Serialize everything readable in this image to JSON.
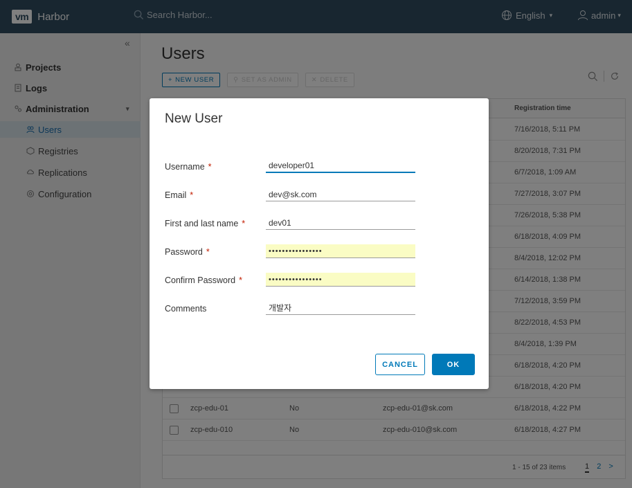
{
  "header": {
    "logo": "vm",
    "app_name": "Harbor",
    "search_placeholder": "Search Harbor...",
    "language": "English",
    "user": "admin"
  },
  "sidebar": {
    "items": [
      {
        "label": "Projects"
      },
      {
        "label": "Logs"
      },
      {
        "label": "Administration"
      }
    ],
    "sub_items": [
      {
        "label": "Users"
      },
      {
        "label": "Registries"
      },
      {
        "label": "Replications"
      },
      {
        "label": "Configuration"
      }
    ]
  },
  "main": {
    "title": "Users",
    "toolbar": {
      "new_user": "NEW USER",
      "set_admin": "SET AS ADMIN",
      "delete": "DELETE"
    },
    "grid": {
      "registration_header": "Registration time",
      "registration_times": [
        "7/16/2018, 5:11 PM",
        "8/20/2018, 7:31 PM",
        "6/7/2018, 1:09 AM",
        "7/27/2018, 3:07 PM",
        "7/26/2018, 5:38 PM",
        "6/18/2018, 4:09 PM",
        "8/4/2018, 12:02 PM",
        "6/14/2018, 1:38 PM",
        "7/12/2018, 3:59 PM",
        "8/22/2018, 4:53 PM",
        "8/4/2018, 1:39 PM",
        "6/18/2018, 4:20 PM",
        "6/18/2018, 4:20 PM"
      ],
      "rows": [
        {
          "username": "zcp-edu-01",
          "admin": "No",
          "email": "zcp-edu-01@sk.com",
          "time": "6/18/2018, 4:22 PM"
        },
        {
          "username": "zcp-edu-010",
          "admin": "No",
          "email": "zcp-edu-010@sk.com",
          "time": "6/18/2018, 4:27 PM"
        }
      ],
      "footer": {
        "count": "1 - 15 of 23 items",
        "page1": "1",
        "page2": "2",
        "next": ">"
      }
    }
  },
  "modal": {
    "title": "New User",
    "fields": {
      "username": {
        "label": "Username",
        "value": "developer01"
      },
      "email": {
        "label": "Email",
        "value": "dev@sk.com"
      },
      "fullname": {
        "label": "First and last name",
        "value": "dev01"
      },
      "password": {
        "label": "Password",
        "value": "••••••••••••••••"
      },
      "confirm": {
        "label": "Confirm Password",
        "value": "••••••••••••••••"
      },
      "comments": {
        "label": "Comments",
        "value": "개발자"
      }
    },
    "required_mark": "*",
    "cancel": "CANCEL",
    "ok": "OK"
  }
}
